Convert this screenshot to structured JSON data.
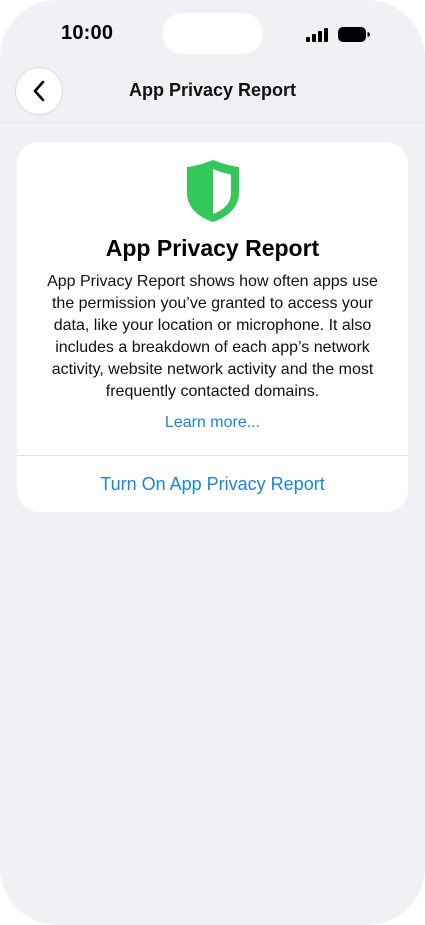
{
  "status_bar": {
    "time": "10:00"
  },
  "nav": {
    "title": "App Privacy Report",
    "back_icon": "chevron-left-icon"
  },
  "card": {
    "icon": "shield-icon",
    "icon_color": "#34c759",
    "title": "App Privacy Report",
    "description": "App Privacy Report shows how often apps use the permission you’ve granted to access your data, like your location or microphone. It also includes a breakdown of each app’s network activity, website network activity and the most frequently contacted domains.",
    "learn_more": "Learn more...",
    "action_label": "Turn On App Privacy Report"
  },
  "colors": {
    "accent": "#1a86d8",
    "background": "#f0f0f5"
  }
}
